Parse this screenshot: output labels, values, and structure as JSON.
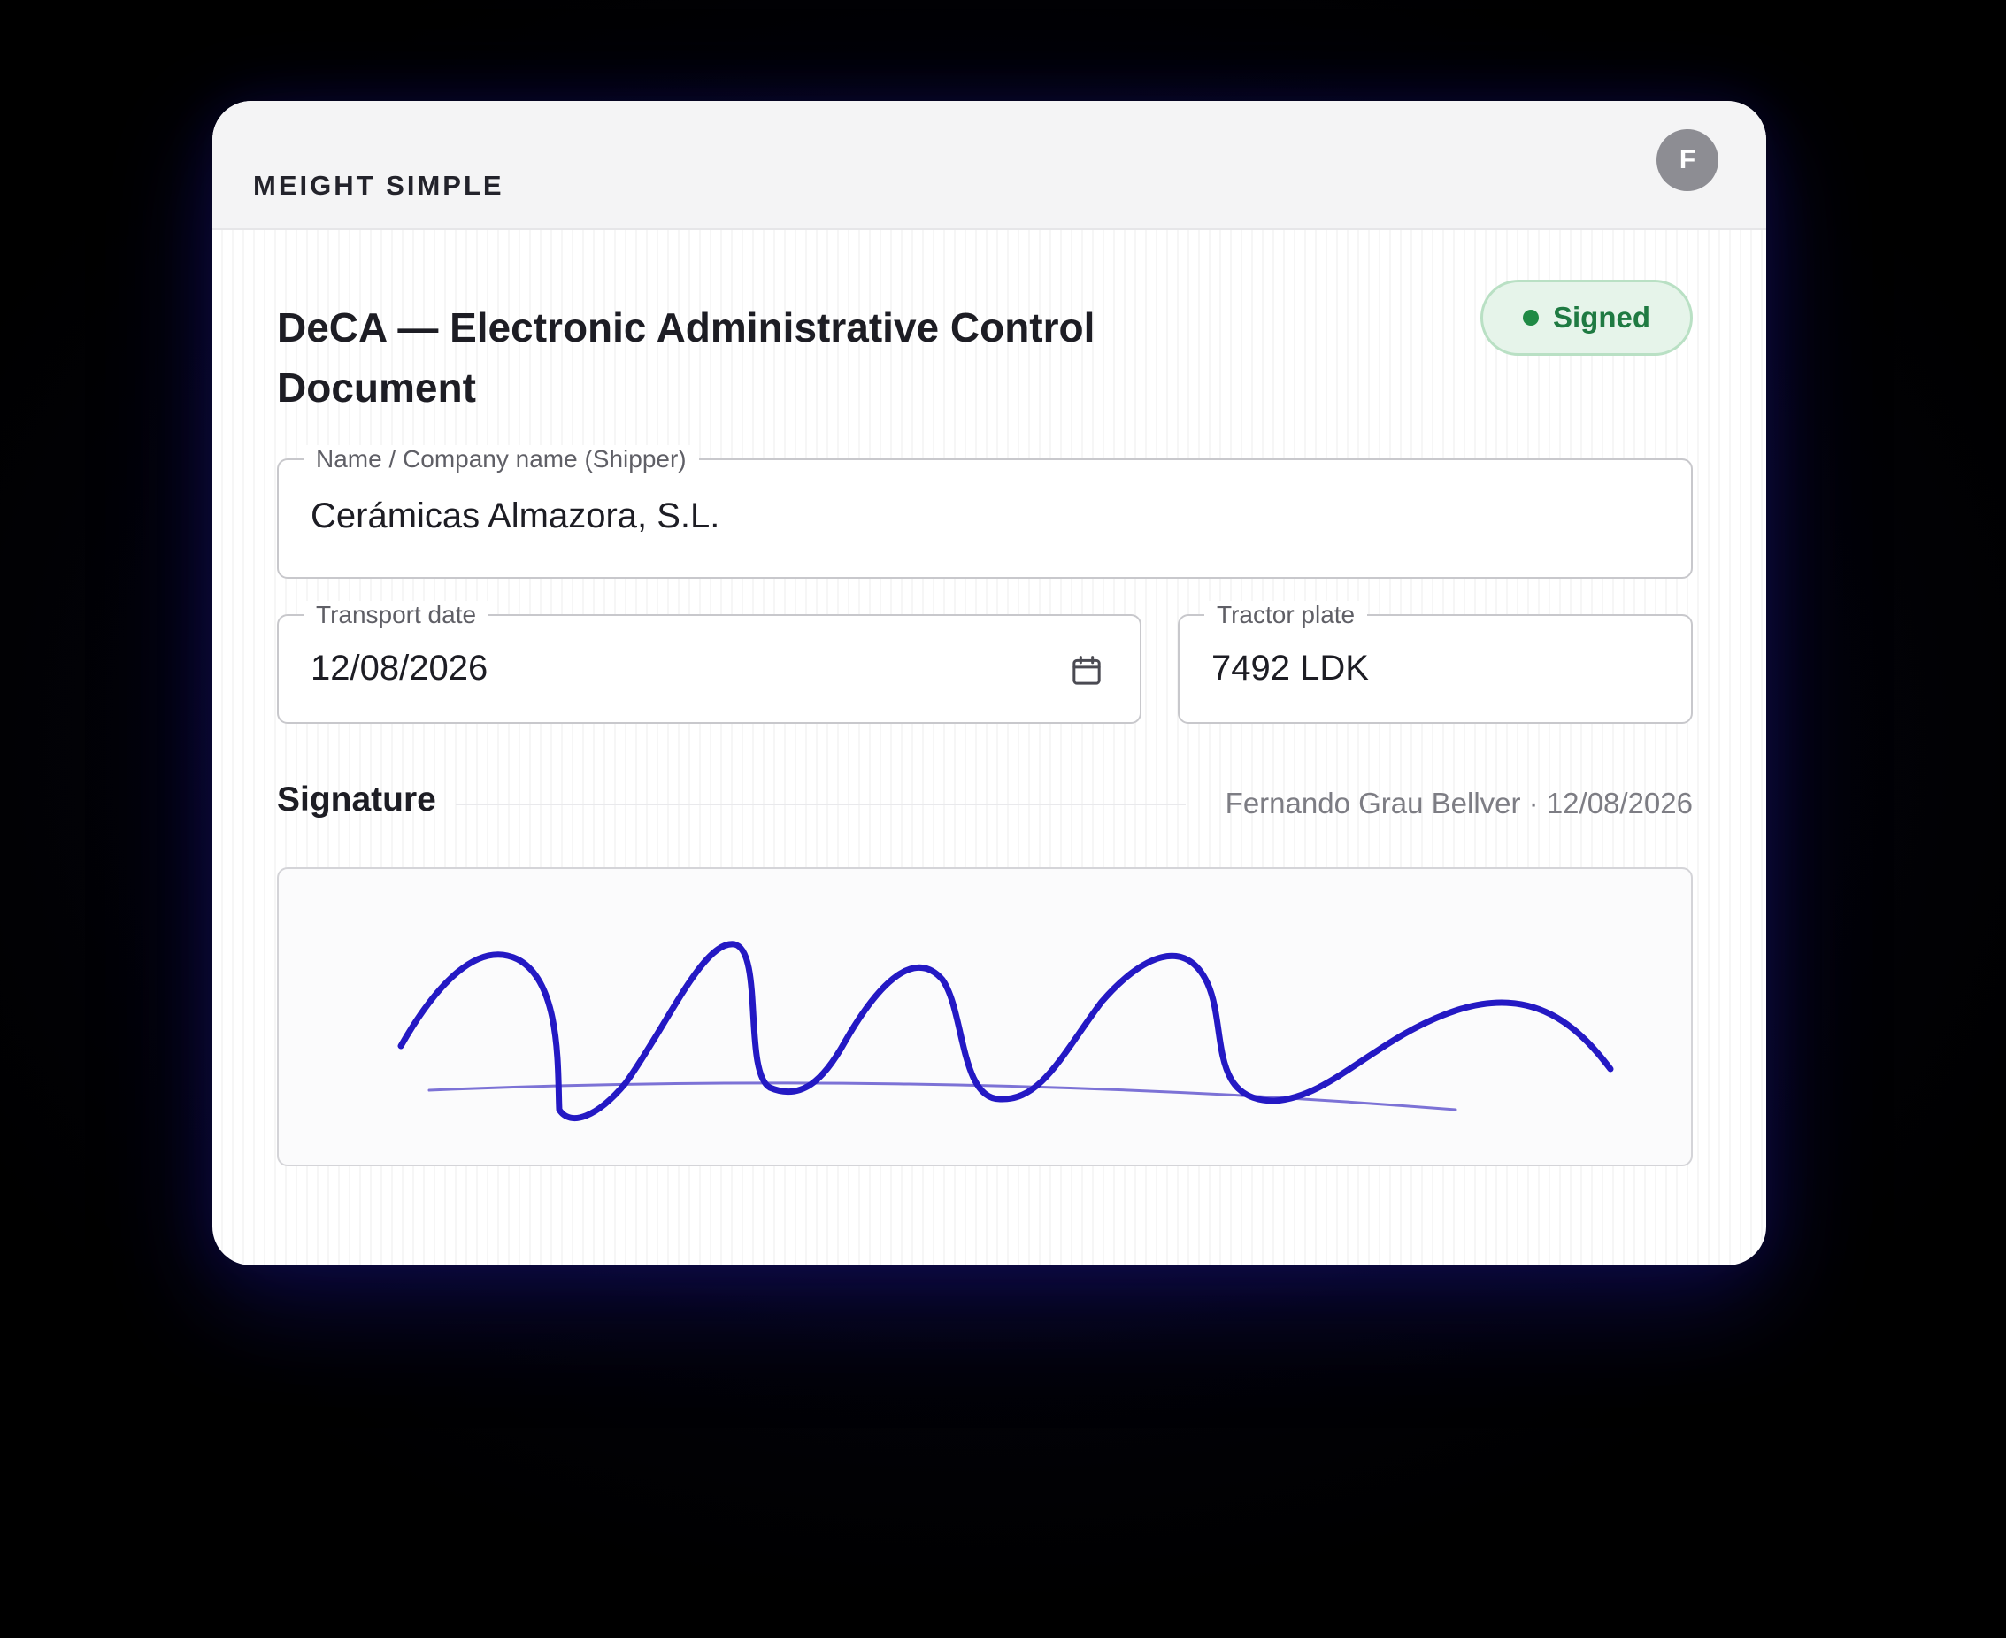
{
  "header": {
    "brand": "MEIGHT SIMPLE",
    "avatar_initial": "F"
  },
  "document": {
    "title": "DeCA — Electronic Administrative Control Document",
    "status": {
      "label": "Signed",
      "color": "#1f8a45"
    }
  },
  "fields": {
    "shipper": {
      "label": "Name / Company name (Shipper)",
      "value": "Cerámicas Almazora, S.L."
    },
    "transport_date": {
      "label": "Transport date",
      "value": "12/08/2026",
      "icon": "calendar-icon"
    },
    "tractor_plate": {
      "label": "Tractor plate",
      "value": "7492 LDK"
    }
  },
  "signature": {
    "title": "Signature",
    "meta": "Fernando Grau Bellver · 12/08/2026",
    "stroke_color": "#2419c4",
    "baseline_color": "#7c72d6"
  },
  "colors": {
    "background": "#05051a",
    "accent_green": "#1f8a45"
  }
}
